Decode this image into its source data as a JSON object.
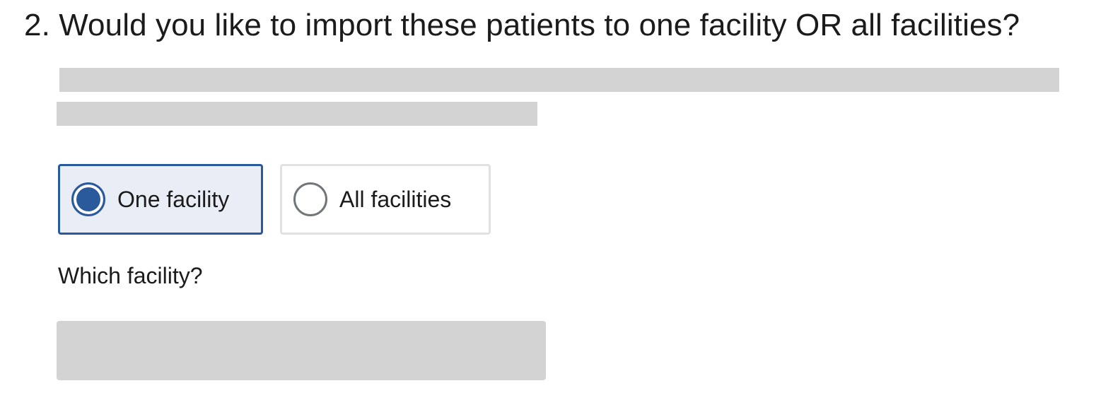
{
  "question": {
    "title": "2. Would you like to import these patients to one facility OR all facilities?"
  },
  "options": [
    {
      "label": "One facility",
      "selected": true
    },
    {
      "label": "All facilities",
      "selected": false
    }
  ],
  "facility_field": {
    "label": "Which facility?"
  },
  "colors": {
    "accent": "#2a5a9c",
    "selected_background": "#e8edf6",
    "skeleton": "#d3d3d3",
    "unselected_border": "#dfe1e2",
    "text": "#1b1b1b"
  }
}
